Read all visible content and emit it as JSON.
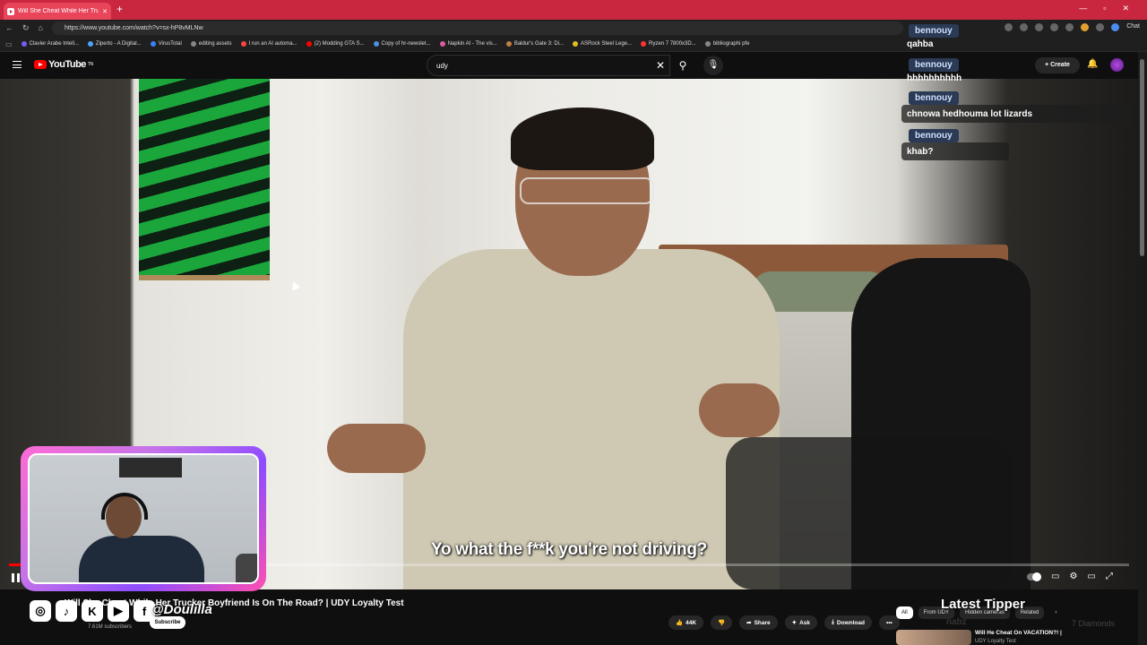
{
  "browser": {
    "tab_title": "Will She Cheat While Her Truc",
    "new_tab": "+",
    "url": "https://www.youtube.com/watch?v=sx-hP8vMLNw",
    "bookmarks": [
      {
        "label": "Clavier Arabe Intell...",
        "color": "#7a5af8"
      },
      {
        "label": "Ziperto - A Digital...",
        "color": "#4aa3ff"
      },
      {
        "label": "VirusTotal",
        "color": "#3b82f6"
      },
      {
        "label": "editing assets",
        "color": "#888888"
      },
      {
        "label": "I run an AI automa...",
        "color": "#ff4444"
      },
      {
        "label": "(2) Modding GTA S...",
        "color": "#ff0000"
      },
      {
        "label": "Copy of hr-newslet...",
        "color": "#4a90e2"
      },
      {
        "label": "Napkin AI - The vis...",
        "color": "#e05aa0"
      },
      {
        "label": "Baldur's Gate 3: Di...",
        "color": "#c08040"
      },
      {
        "label": "ASRock Steel Lege...",
        "color": "#e0c020"
      },
      {
        "label": "Ryzen 7 7800x3D...",
        "color": "#ff3333"
      },
      {
        "label": "bibliographi pfe",
        "color": "#888888"
      }
    ],
    "chat_label": "Chat"
  },
  "youtube": {
    "logo_text": "YouTube",
    "logo_sup": "TN",
    "search_value": "udy",
    "create_label": "Create",
    "video_subtitle": "Yo what the f**k you're not driving?",
    "progress": 0.02,
    "video_title": "Will She Cheat While Her Trucker Boyfriend Is On The Road? | UDY Loyalty Test",
    "channel_subs": "7.61M subscribers",
    "subscribe_label": "Subscribe",
    "like_count": "44K",
    "share_label": "Share",
    "ask_label": "Ask",
    "download_label": "Download",
    "chips": [
      "All",
      "From UDY",
      "Hidden cameras",
      "Related"
    ],
    "related_title": "Will He Cheat On VACATION?! |",
    "related_channel": "UDY Loyalty Test"
  },
  "overlay": {
    "social_handle": "@Doulilla",
    "social_icons": [
      "instagram-icon",
      "tiktok-icon",
      "kick-icon",
      "youtube-icon",
      "facebook-icon"
    ],
    "social_glyphs": [
      "◎",
      "♪",
      "K",
      "▶",
      "f"
    ],
    "latest_tipper_label": "Latest Tipper",
    "tipper_name": "nabz",
    "tipper_amount": "7 Diamonds"
  },
  "chat": [
    {
      "user": "bennouy",
      "text": "qahba"
    },
    {
      "user": "bennouy",
      "text": "hhhhhhhhhh"
    },
    {
      "user": "bennouy",
      "text": "chnowa hedhouma lot lizards"
    },
    {
      "user": "bennouy",
      "text": "khab?"
    }
  ],
  "colors": {
    "brand_red": "#ff0000",
    "tab_bar": "#c8273f",
    "webcam_border": "#c774e8"
  }
}
